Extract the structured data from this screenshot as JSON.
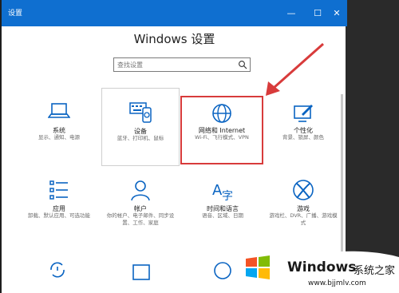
{
  "window": {
    "title": "设置",
    "heading": "Windows 设置",
    "controls": {
      "minimize": "—",
      "maximize": "☐",
      "close": "✕"
    }
  },
  "search": {
    "placeholder": "查找设置"
  },
  "tiles": [
    {
      "label": "系统",
      "desc": "显示、通知、电源",
      "icon": "laptop-icon"
    },
    {
      "label": "设备",
      "desc": "蓝牙、打印机、鼠标",
      "icon": "devices-icon"
    },
    {
      "label": "网络和 Internet",
      "desc": "Wi-Fi、飞行模式、VPN",
      "icon": "globe-icon"
    },
    {
      "label": "个性化",
      "desc": "背景、锁屏、颜色",
      "icon": "personalization-icon"
    },
    {
      "label": "应用",
      "desc": "卸载、默认应用、可选功能",
      "icon": "apps-icon"
    },
    {
      "label": "帐户",
      "desc": "你的帐户、电子邮件、同步设置、工作、家庭",
      "desc1": "你的帐户、电子邮件、同步设",
      "desc2": "置、工作、家庭",
      "icon": "account-icon"
    },
    {
      "label": "时间和语言",
      "desc": "语音、区域、日期",
      "icon": "time-language-icon"
    },
    {
      "label": "游戏",
      "desc": "游戏栏、DVR、广播、游戏模式",
      "desc1": "游戏栏、DVR、广播、游戏模",
      "desc2": "式",
      "icon": "xbox-icon"
    }
  ],
  "watermark": {
    "brand": "Windows",
    "brand_cn": "系统之家",
    "url": "www.bjjmlv.com"
  },
  "colors": {
    "titlebar": "#0f6fd0",
    "icon_blue": "#0a64c2",
    "highlight_red": "#d83b3b"
  }
}
